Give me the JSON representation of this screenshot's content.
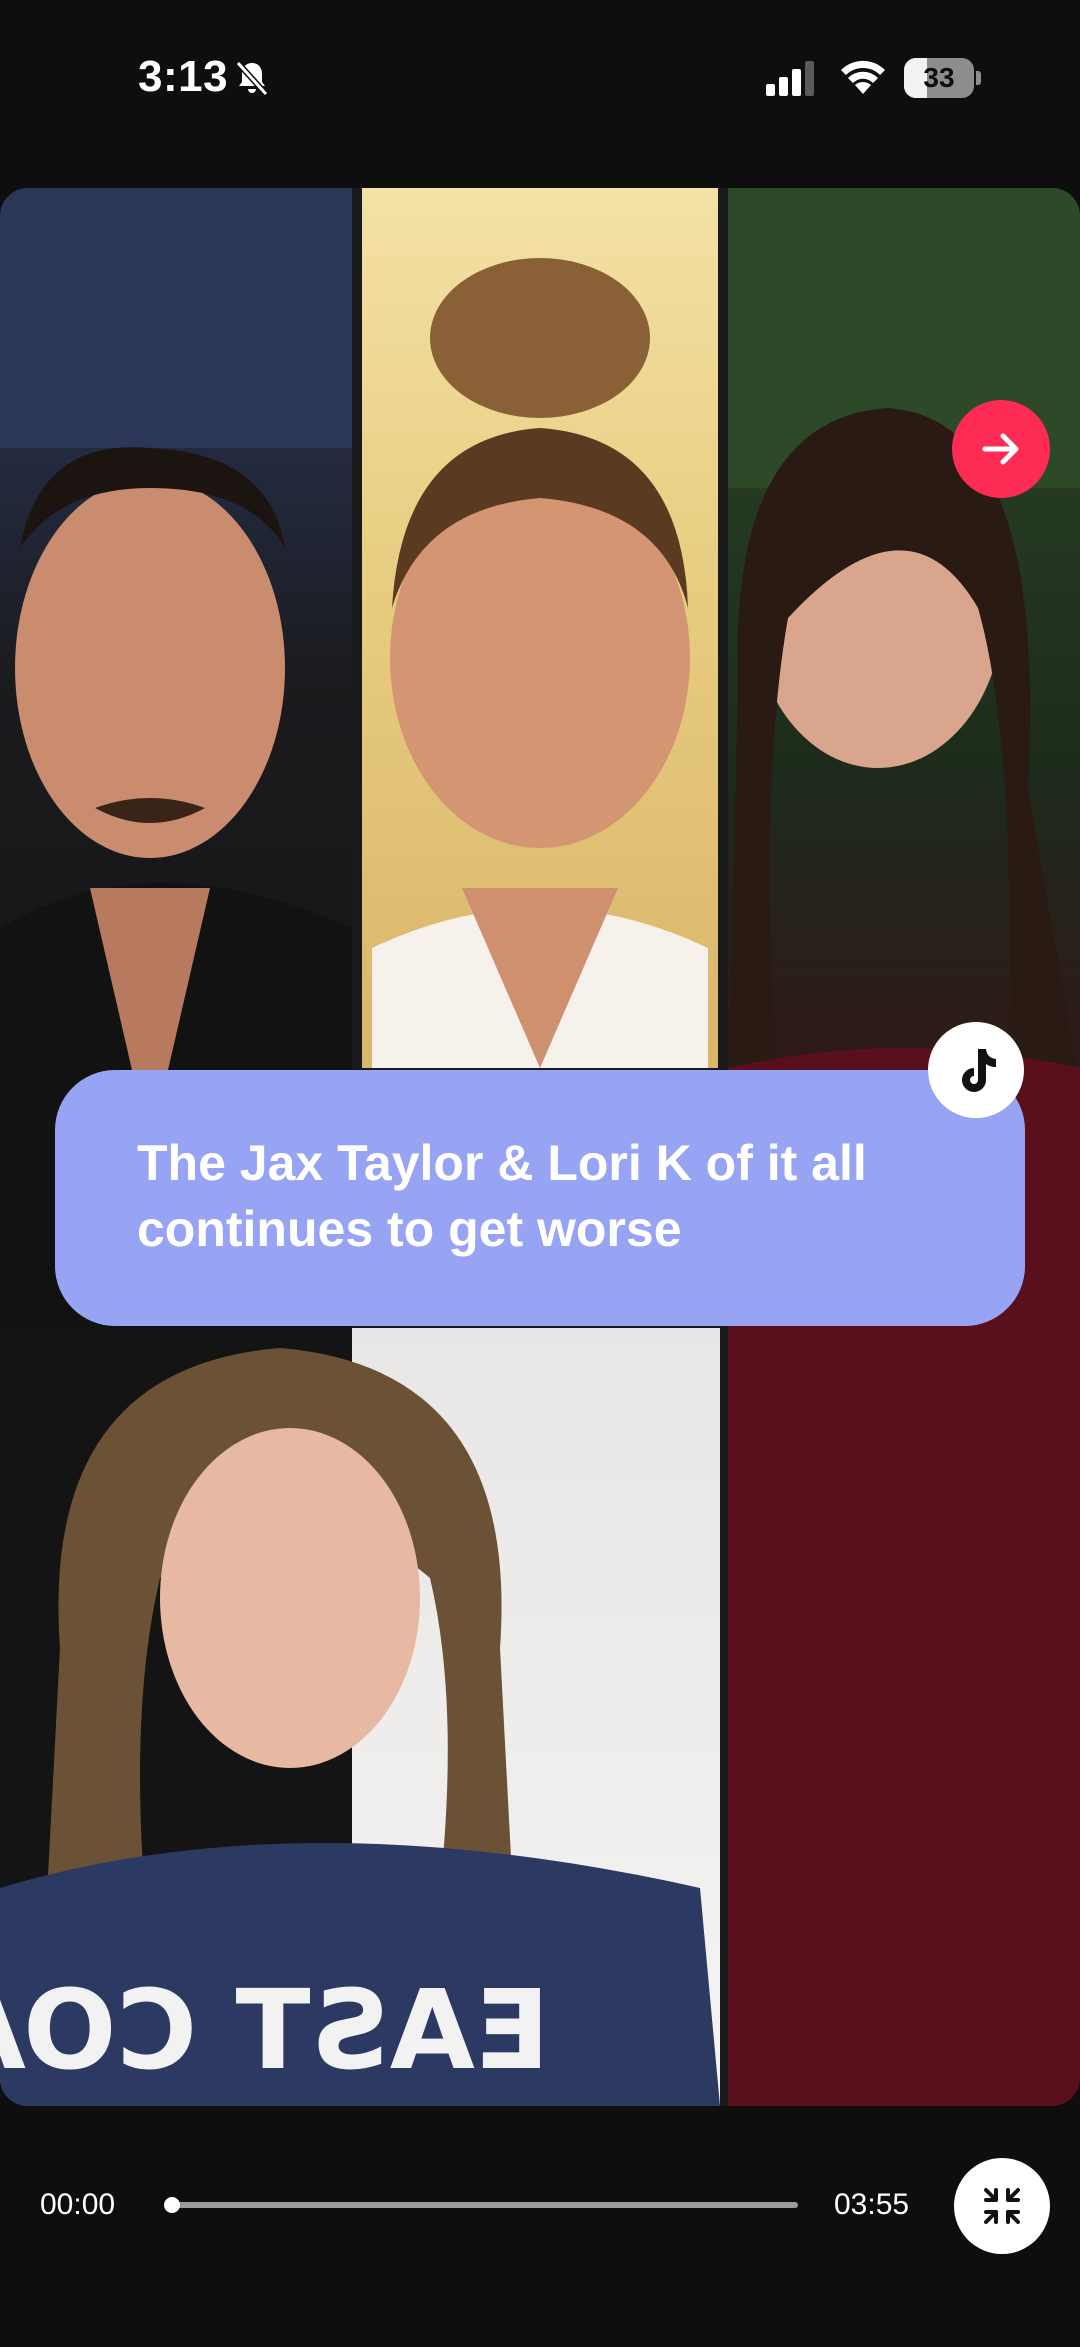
{
  "status_bar": {
    "time": "3:13",
    "battery_level": "33",
    "battery_fraction": 0.33,
    "icons": [
      "bell-slash-icon",
      "cellular-signal-icon",
      "wifi-icon",
      "battery-icon"
    ]
  },
  "video": {
    "title_banner": "The Jax Taylor & Lori K of it all continues to get worse",
    "icons": [
      "arrow-right-icon",
      "tiktok-logo-icon"
    ],
    "colors": {
      "arrow_button": "#fe2c55",
      "banner": "#97a3f3"
    }
  },
  "player": {
    "current_time": "00:00",
    "total_time": "03:55",
    "progress_fraction": 0.0,
    "icons": [
      "collapse-icon"
    ]
  }
}
